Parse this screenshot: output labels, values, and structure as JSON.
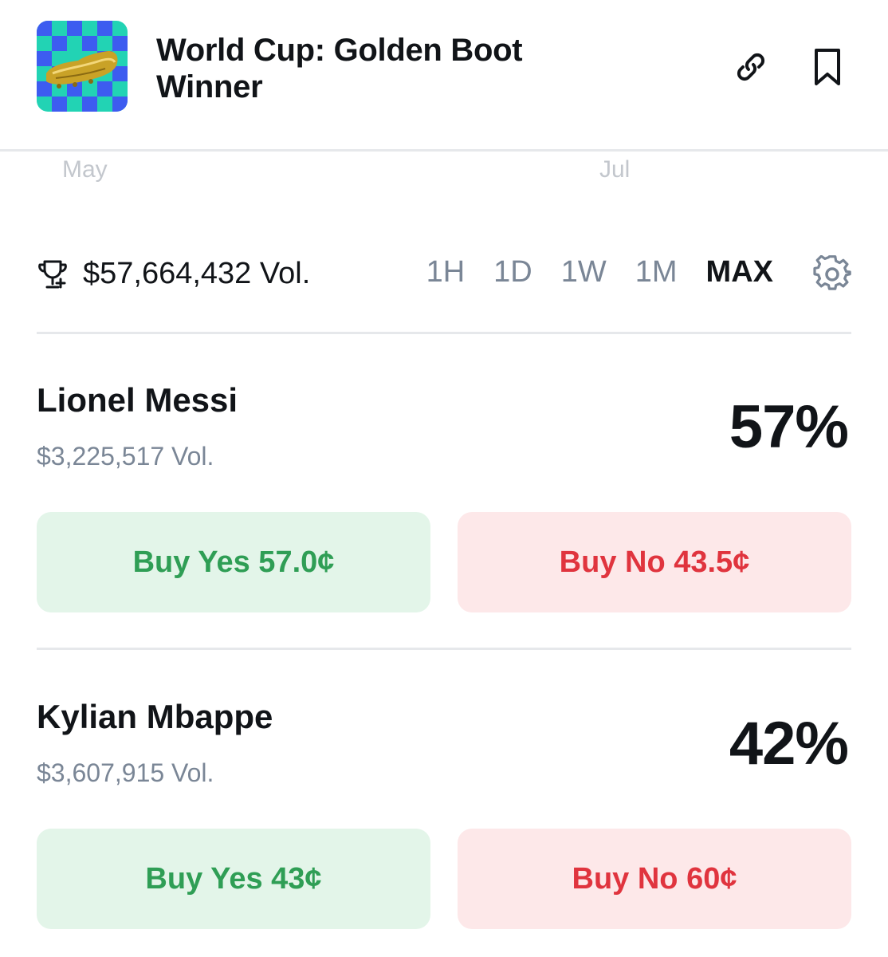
{
  "header": {
    "title": "World Cup: Golden Boot Winner",
    "thumbnail_icon": "golden-boot-image",
    "link_icon": "link-icon",
    "bookmark_icon": "bookmark-icon"
  },
  "chart_axis": {
    "x_labels": [
      "May",
      "Jul"
    ]
  },
  "volume_row": {
    "total_volume": "$57,664,432 Vol.",
    "ranges": [
      "1H",
      "1D",
      "1W",
      "1M",
      "MAX"
    ],
    "active_range": "MAX"
  },
  "outcomes": [
    {
      "name": "Lionel Messi",
      "volume": "$3,225,517 Vol.",
      "percent": "57%",
      "buy_yes": "Buy Yes 57.0¢",
      "buy_no": "Buy No 43.5¢"
    },
    {
      "name": "Kylian Mbappe",
      "volume": "$3,607,915 Vol.",
      "percent": "42%",
      "buy_yes": "Buy Yes 43¢",
      "buy_no": "Buy No 60¢"
    }
  ],
  "colors": {
    "yes_bg": "#e3f5e9",
    "yes_text": "#2f9e55",
    "no_bg": "#fde8e9",
    "no_text": "#e0343e",
    "thumb_teal": "#22d3b4",
    "thumb_blue": "#3d5cf0"
  }
}
